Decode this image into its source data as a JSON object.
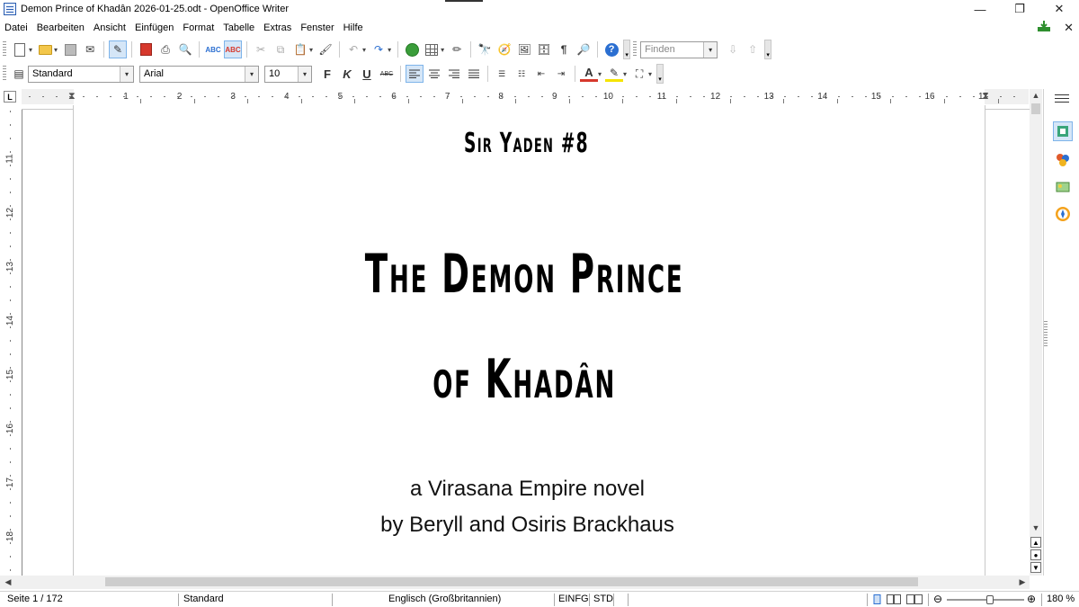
{
  "window": {
    "title": "Demon Prince of Khadân 2026-01-25.odt - OpenOffice Writer",
    "controls": {
      "minimize": "—",
      "restore": "❐",
      "close": "✕"
    }
  },
  "menu": {
    "items": [
      "Datei",
      "Bearbeiten",
      "Ansicht",
      "Einfügen",
      "Format",
      "Tabelle",
      "Extras",
      "Fenster",
      "Hilfe"
    ],
    "doc_close": "✕"
  },
  "toolbar_standard": {
    "find_placeholder": "Finden"
  },
  "toolbar_format": {
    "style_value": "Standard",
    "font_value": "Arial",
    "size_value": "10",
    "bold_label": "F",
    "italic_label": "K",
    "underline_label": "U",
    "strike_label": "ABC",
    "font_color_label": "A"
  },
  "ruler_h": {
    "corner": "L",
    "numbers": [
      "1",
      "2",
      "3",
      "4",
      "5",
      "6",
      "7",
      "8",
      "9",
      "10",
      "11",
      "12",
      "13",
      "14",
      "15",
      "16",
      "17"
    ]
  },
  "ruler_v": {
    "numbers": [
      "11",
      "12",
      "13",
      "14",
      "15",
      "16",
      "17",
      "18"
    ]
  },
  "document": {
    "series": "Sir Yaden #8",
    "title_line1": "The Demon Prince",
    "title_line2": "of Khadân",
    "subtitle": "a Virasana Empire novel",
    "byline": "by Beryll and Osiris Brackhaus"
  },
  "statusbar": {
    "page": "Seite 1 / 172",
    "style": "Standard",
    "language": "Englisch (Großbritannien)",
    "insert_mode": "EINFG",
    "selection_mode": "STD",
    "zoom": "180 %"
  },
  "colors": {
    "accent_blue": "#2b6fd1",
    "active_button": "#d5e6f7",
    "scrollbar": "#f0f0f0"
  }
}
